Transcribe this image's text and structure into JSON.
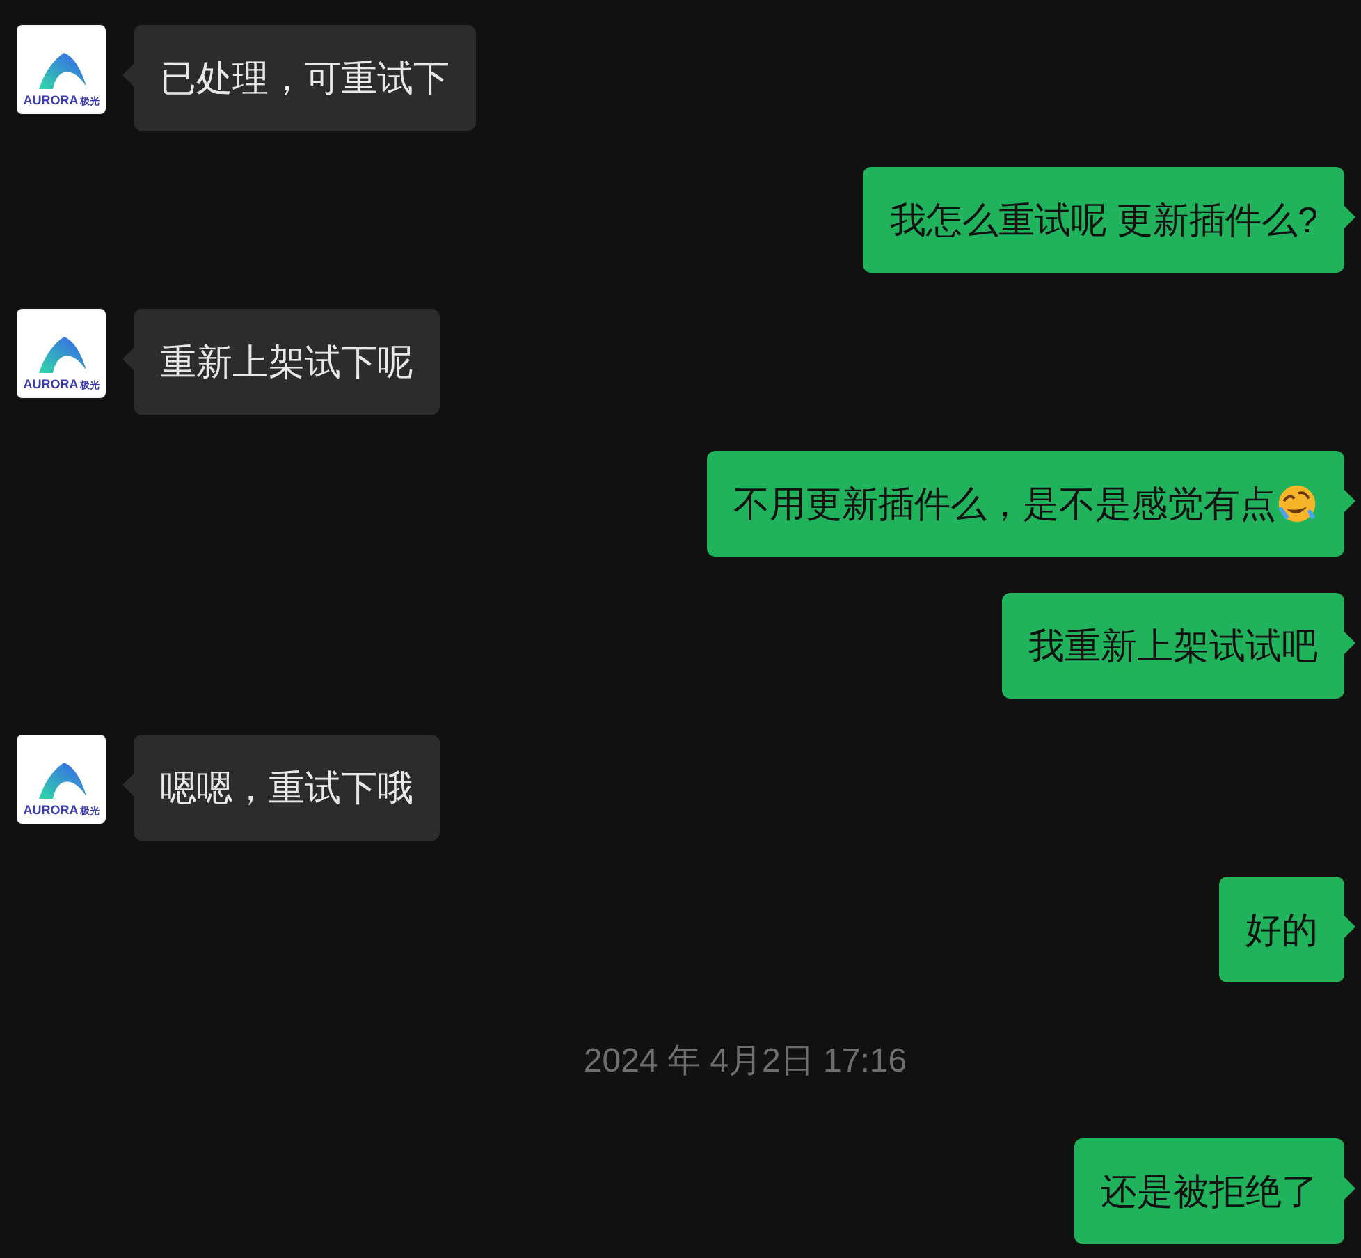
{
  "messages": [
    {
      "kind": "incoming",
      "text": "已处理，可重试下",
      "avatar": {
        "brand": "AURORA",
        "brand_cjk": "极光"
      }
    },
    {
      "kind": "outgoing",
      "text": "我怎么重试呢 更新插件么?",
      "trailing_emoji": false
    },
    {
      "kind": "incoming",
      "text": "重新上架试下呢",
      "avatar": {
        "brand": "AURORA",
        "brand_cjk": "极光"
      }
    },
    {
      "kind": "outgoing",
      "text": "不用更新插件么，是不是感觉有点",
      "trailing_emoji": true
    },
    {
      "kind": "outgoing",
      "text": "我重新上架试试吧",
      "trailing_emoji": false
    },
    {
      "kind": "incoming",
      "text": "嗯嗯，重试下哦",
      "avatar": {
        "brand": "AURORA",
        "brand_cjk": "极光"
      }
    },
    {
      "kind": "outgoing",
      "text": "好的",
      "trailing_emoji": false
    },
    {
      "kind": "timestamp",
      "text": "2024 年 4月2日 17:16"
    },
    {
      "kind": "outgoing",
      "text": "还是被拒绝了",
      "trailing_emoji": false
    }
  ]
}
